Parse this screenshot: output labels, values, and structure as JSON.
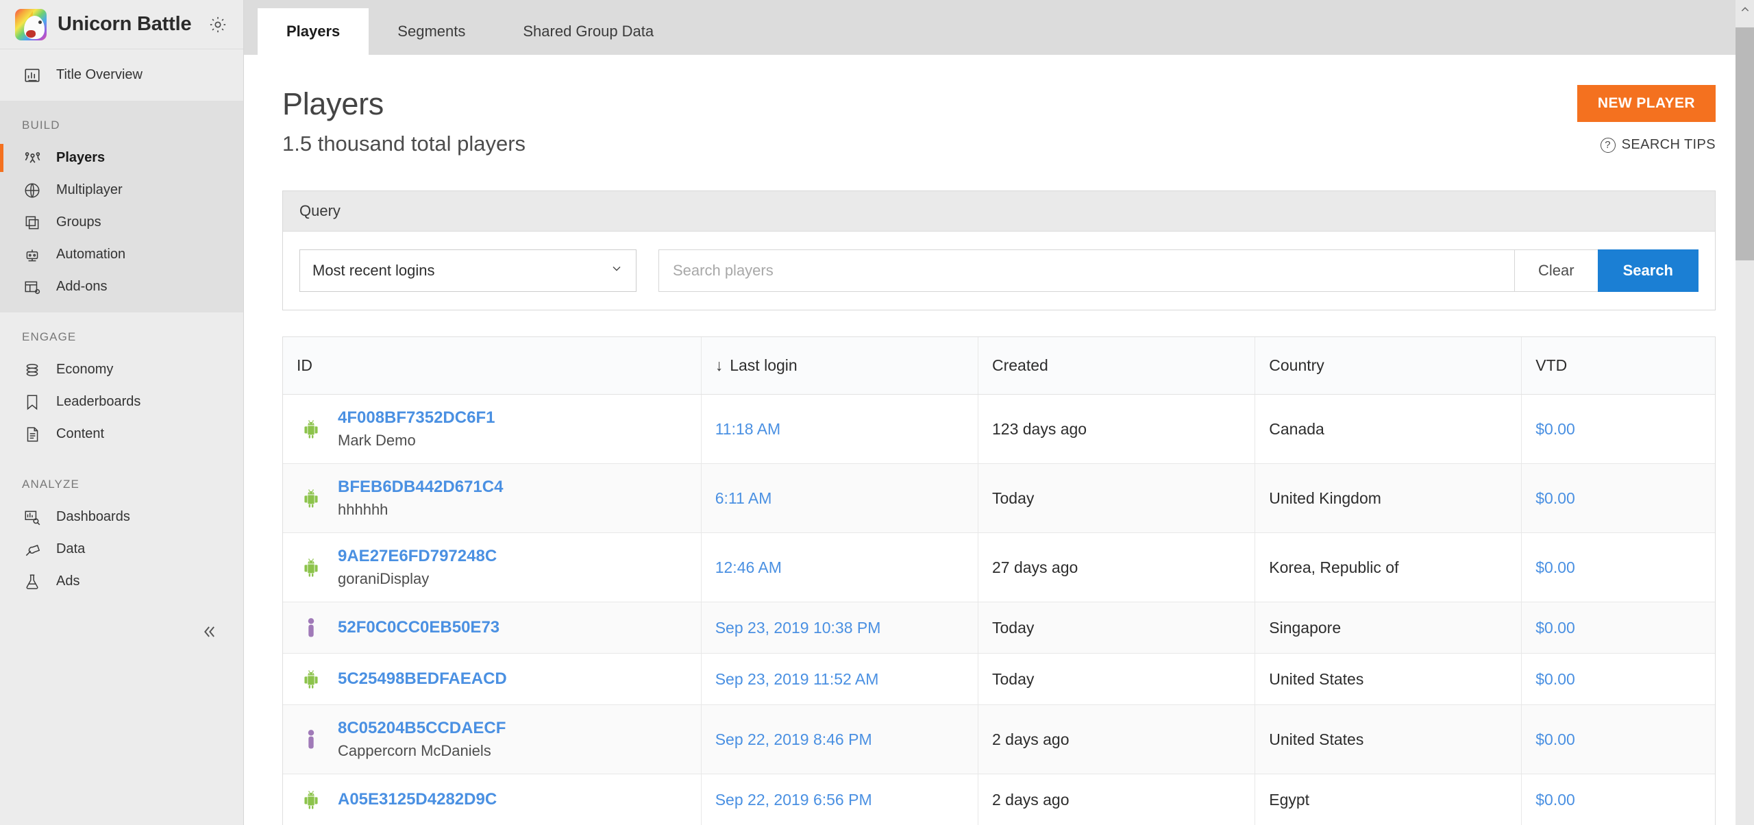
{
  "sidebar": {
    "brand": {
      "title": "Unicorn Battle",
      "gear_icon": "gear-icon",
      "logo_icon": "unicorn-logo"
    },
    "top_items": [
      {
        "label": "Title Overview",
        "icon": "chart-bars-icon"
      }
    ],
    "sections": [
      {
        "label": "BUILD",
        "items": [
          {
            "label": "Players",
            "icon": "people-icon",
            "active": true
          },
          {
            "label": "Multiplayer",
            "icon": "globe-icon",
            "active": false
          },
          {
            "label": "Groups",
            "icon": "stacked-squares-icon",
            "active": false
          },
          {
            "label": "Automation",
            "icon": "robot-icon",
            "active": false
          },
          {
            "label": "Add-ons",
            "icon": "table-gear-icon",
            "active": false
          }
        ]
      },
      {
        "label": "ENGAGE",
        "items": [
          {
            "label": "Economy",
            "icon": "coins-stack-icon",
            "active": false
          },
          {
            "label": "Leaderboards",
            "icon": "bookmark-icon",
            "active": false
          },
          {
            "label": "Content",
            "icon": "document-icon",
            "active": false
          }
        ]
      },
      {
        "label": "ANALYZE",
        "items": [
          {
            "label": "Dashboards",
            "icon": "dashboard-search-icon",
            "active": false
          },
          {
            "label": "Data",
            "icon": "plug-icon",
            "active": false
          },
          {
            "label": "Ads",
            "icon": "flask-icon",
            "active": false
          }
        ]
      }
    ],
    "collapse_icon": "double-chevron-left-icon",
    "accent_color": "#f4711f"
  },
  "tabs": [
    {
      "label": "Players",
      "active": true
    },
    {
      "label": "Segments",
      "active": false
    },
    {
      "label": "Shared Group Data",
      "active": false
    }
  ],
  "page": {
    "title": "Players",
    "subtitle": "1.5 thousand total players",
    "new_player_label": "NEW PLAYER",
    "search_tips_label": "SEARCH TIPS",
    "search_tips_icon": "question-circle-icon",
    "new_player_color": "#f4711f"
  },
  "query": {
    "panel_title": "Query",
    "select_value": "Most recent logins",
    "select_chevron": "chevron-down-icon",
    "search_placeholder": "Search players",
    "search_value": "",
    "clear_label": "Clear",
    "search_label": "Search",
    "search_button_color": "#1b7fd4"
  },
  "table": {
    "columns": [
      {
        "label": "ID",
        "sorted": false
      },
      {
        "label": "Last login",
        "sorted": true,
        "sort_icon": "arrow-down-icon"
      },
      {
        "label": "Created",
        "sorted": false
      },
      {
        "label": "Country",
        "sorted": false
      },
      {
        "label": "VTD",
        "sorted": false
      }
    ],
    "rows": [
      {
        "platform_icon": "android-icon",
        "id": "4F008BF7352DC6F1",
        "display_name": "Mark Demo",
        "last_login": "11:18 AM",
        "created": "123 days ago",
        "country": "Canada",
        "vtd": "$0.00"
      },
      {
        "platform_icon": "android-icon",
        "id": "BFEB6DB442D671C4",
        "display_name": "hhhhhh",
        "last_login": "6:11 AM",
        "created": "Today",
        "country": "United Kingdom",
        "vtd": "$0.00"
      },
      {
        "platform_icon": "android-icon",
        "id": "9AE27E6FD797248C",
        "display_name": "goraniDisplay",
        "last_login": "12:46 AM",
        "created": "27 days ago",
        "country": "Korea, Republic of",
        "vtd": "$0.00"
      },
      {
        "platform_icon": "person-icon",
        "id": "52F0C0CC0EB50E73",
        "display_name": "",
        "last_login": "Sep 23, 2019 10:38 PM",
        "created": "Today",
        "country": "Singapore",
        "vtd": "$0.00"
      },
      {
        "platform_icon": "android-icon",
        "id": "5C25498BEDFAEACD",
        "display_name": "",
        "last_login": "Sep 23, 2019 11:52 AM",
        "created": "Today",
        "country": "United States",
        "vtd": "$0.00"
      },
      {
        "platform_icon": "person-icon",
        "id": "8C05204B5CCDAECF",
        "display_name": "Cappercorn McDaniels",
        "last_login": "Sep 22, 2019 8:46 PM",
        "created": "2 days ago",
        "country": "United States",
        "vtd": "$0.00"
      },
      {
        "platform_icon": "android-icon",
        "id": "A05E3125D4282D9C",
        "display_name": "",
        "last_login": "Sep 22, 2019 6:56 PM",
        "created": "2 days ago",
        "country": "Egypt",
        "vtd": "$0.00"
      }
    ],
    "android_color": "#8cc34b",
    "person_color": "#a07ab8",
    "link_color": "#4a90e2"
  }
}
